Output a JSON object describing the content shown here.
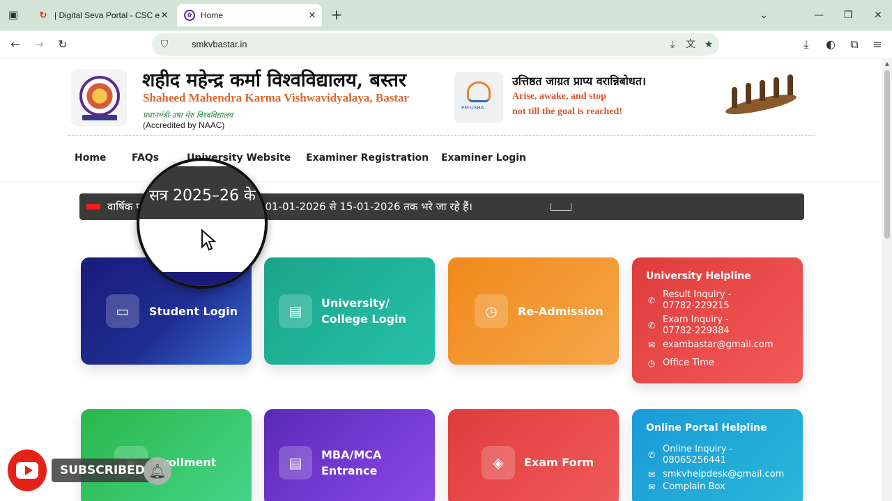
{
  "browser": {
    "tabs": [
      {
        "title": "| Digital Seva Portal - CSC e-Gov",
        "favicon": "csc-logo-icon",
        "active": false
      },
      {
        "title": "Home",
        "favicon": "university-logo-icon",
        "active": true
      }
    ],
    "url": "smkvbastar.in"
  },
  "header": {
    "title_hindi": "शहीद महेन्द्र कर्मा विश्वविद्यालय, बस्तर",
    "title_english": "Shaheed Mahendra Karma Vishwavidyalaya, Bastar",
    "subtitle_hindi": "प्रधानमंत्री-उषा मेरु विश्वविद्यालय",
    "accreditation": "(Accredited by NAAC)",
    "motto_hindi": "उत्तिष्ठत जाग्रत प्राप्य वरान्निबोधत।",
    "motto_english_line1": "Arise, awake, and stop",
    "motto_english_line2": "not till the goal is reached!",
    "pm_usha_caption": "PM-USHA"
  },
  "nav": {
    "items": [
      "Home",
      "FAQs",
      "University Website",
      "Examiner Registration",
      "Examiner Login"
    ]
  },
  "ticker": {
    "text_start": "वार्षिक प",
    "text_end": "ऑनलाइन आवेदन 01-01-2026 से 15-01-2026 तक भरे जा रहे हैं।",
    "magnified_text": "सत्र 2025–26 के"
  },
  "cards": {
    "student_login": {
      "label": "Student Login",
      "icon": "laptop-icon"
    },
    "university_login": {
      "label_line1": "University/",
      "label_line2": "College Login",
      "icon": "building-icon"
    },
    "readmission": {
      "label": "Re-Admission",
      "icon": "clock-icon"
    },
    "enrollment": {
      "label": "rollment",
      "icon": "id-card-icon"
    },
    "mba_mca": {
      "label_line1": "MBA/MCA",
      "label_line2": "Entrance",
      "icon": "building-icon"
    },
    "exam_form": {
      "label": "Exam Form",
      "icon": "layers-icon"
    }
  },
  "university_helpline": {
    "title": "University Helpline",
    "result_label": "Result Inquiry -",
    "result_phone": "07782-229215",
    "exam_label": "Exam Inquiry -",
    "exam_phone": "07782-229884",
    "email": "exambastar@gmail.com",
    "office_time": "Office Time"
  },
  "online_helpline": {
    "title": "Online Portal Helpline",
    "online_label": "Online Inquiry -",
    "online_phone": "08065256441",
    "email": "smkvhelpdesk@gmail.com",
    "complain": "Complain Box"
  },
  "overlay": {
    "subscribed_label": "SUBSCRIBED"
  }
}
